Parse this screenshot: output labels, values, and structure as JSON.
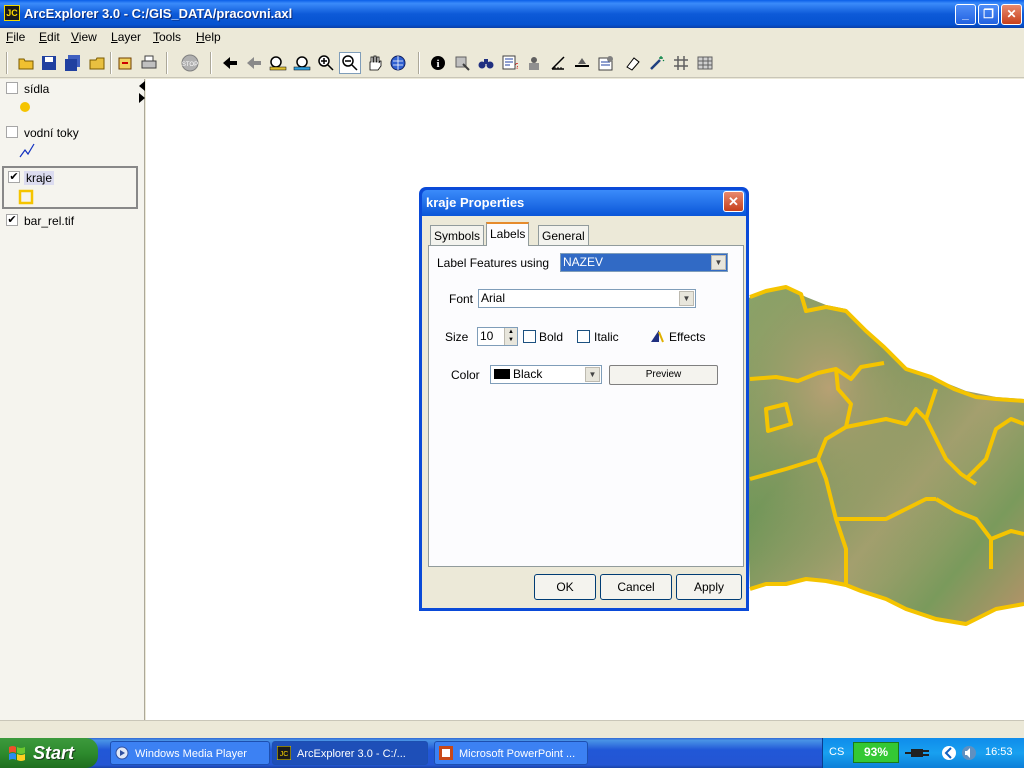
{
  "window": {
    "title": "ArcExplorer 3.0 - C:/GIS_DATA/pracovni.axl",
    "app_icon_text": "JC"
  },
  "menu": [
    "File",
    "Edit",
    "View",
    "Layer",
    "Tools",
    "Help"
  ],
  "layers": [
    {
      "name": "sídla",
      "checked": false,
      "symbol": "yellow-point"
    },
    {
      "name": "vodní toky",
      "checked": false,
      "symbol": "blue-line"
    },
    {
      "name": "kraje",
      "checked": true,
      "symbol": "yellow-polygon",
      "selected": true
    },
    {
      "name": "bar_rel.tif",
      "checked": true,
      "symbol": "none"
    }
  ],
  "dialog": {
    "title": "kraje Properties",
    "tabs": [
      "Symbols",
      "Labels",
      "General"
    ],
    "active_tab": "Labels",
    "label_features_label": "Label Features using",
    "label_features_value": "NAZEV",
    "font_label": "Font",
    "font_value": "Arial",
    "size_label": "Size",
    "size_value": "10",
    "bold_label": "Bold",
    "italic_label": "Italic",
    "effects_label": "Effects",
    "color_label": "Color",
    "color_value": "Black",
    "preview_label": "Preview",
    "ok_label": "OK",
    "cancel_label": "Cancel",
    "apply_label": "Apply"
  },
  "taskbar": {
    "start_label": "Start",
    "items": [
      "Windows Media Player",
      "ArcExplorer 3.0 - C:/...",
      "Microsoft PowerPoint ..."
    ],
    "language": "CS",
    "battery": "93%",
    "clock": "16:53"
  },
  "colors": {
    "boundary": "#f5c400",
    "accent": "#0a4ad8"
  }
}
